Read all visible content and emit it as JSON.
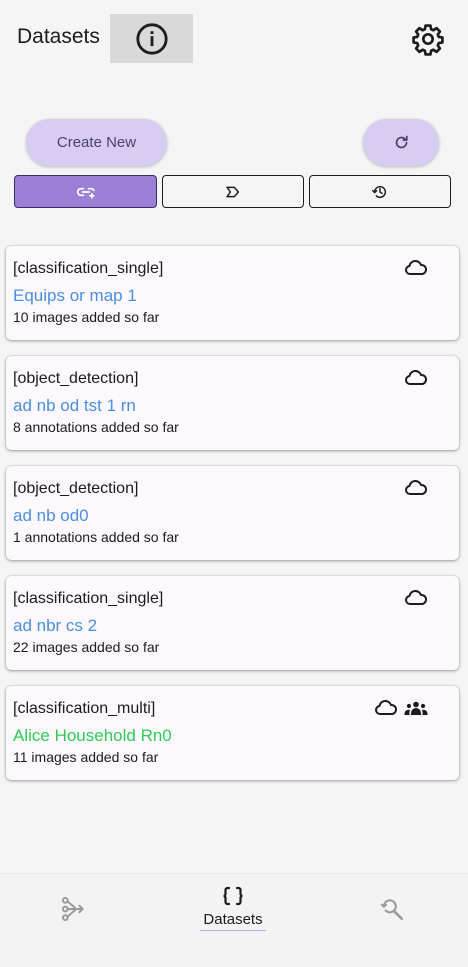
{
  "appbar": {
    "title": "Datasets"
  },
  "actions": {
    "create_label": "Create New"
  },
  "datasets": [
    {
      "type": "[classification_single]",
      "name": "Equips or map 1",
      "count": "10 images added so far",
      "name_color": "#4a8fe0",
      "shared": false
    },
    {
      "type": "[object_detection]",
      "name": "ad nb od tst 1 rn",
      "count": "8 annotations added so far",
      "name_color": "#4a8fe0",
      "shared": false
    },
    {
      "type": "[object_detection]",
      "name": "ad nb od0",
      "count": "1 annotations added so far",
      "name_color": "#4a8fe0",
      "shared": false
    },
    {
      "type": "[classification_single]",
      "name": "ad nbr cs 2",
      "count": "22 images added so far",
      "name_color": "#4a8fe0",
      "shared": false
    },
    {
      "type": "[classification_multi]",
      "name": "Alice Household Rn0",
      "count": "11 images added so far",
      "name_color": "#2ecc55",
      "shared": true
    }
  ],
  "bottom_nav": {
    "center_label": "Datasets"
  },
  "colors": {
    "accent": "#9c7fd6",
    "button_bg": "#d8cdf0",
    "link_blue": "#4a8fe0",
    "link_green": "#2ecc55"
  }
}
